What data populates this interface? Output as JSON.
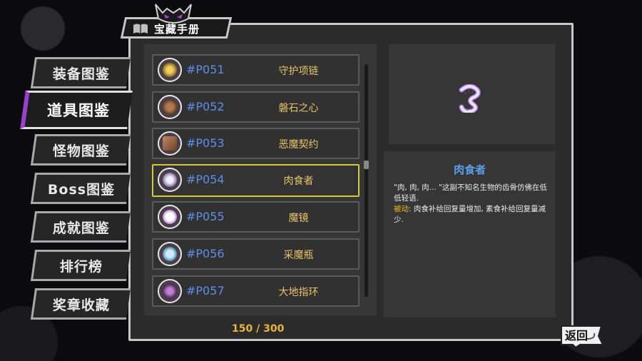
{
  "header": {
    "title": "宝藏手册"
  },
  "sidebar": {
    "items": [
      {
        "label": "装备图鉴",
        "active": false
      },
      {
        "label": "道具图鉴",
        "active": true
      },
      {
        "label": "怪物图鉴",
        "active": false
      },
      {
        "label": "Boss图鉴",
        "active": false
      },
      {
        "label": "成就图鉴",
        "active": false
      },
      {
        "label": "排行榜",
        "active": false
      },
      {
        "label": "奖章收藏",
        "active": false
      }
    ]
  },
  "list": {
    "items": [
      {
        "code": "#P051",
        "name": "守护项链",
        "icon": "necklace-icon",
        "color": "#c9a43a"
      },
      {
        "code": "#P052",
        "name": "磐石之心",
        "icon": "rock-heart-icon",
        "color": "#8a5a3a"
      },
      {
        "code": "#P053",
        "name": "恶魔契约",
        "icon": "scroll-icon",
        "color": "#a07050"
      },
      {
        "code": "#P054",
        "name": "肉食者",
        "icon": "jawbone-icon",
        "color": "#d8d0e8",
        "selected": true
      },
      {
        "code": "#P055",
        "name": "魔镜",
        "icon": "mirror-icon",
        "color": "#f0f0ff"
      },
      {
        "code": "#P056",
        "name": "采魔瓶",
        "icon": "bottle-icon",
        "color": "#6ab0d8"
      },
      {
        "code": "#P057",
        "name": "大地指环",
        "icon": "ring-icon",
        "color": "#7a4a8a"
      }
    ],
    "counter": "150 / 300"
  },
  "detail": {
    "title": "肉食者",
    "description": "\"肉, 肉, 肉... \"这副不知名生物的齿骨仿佛在低低轻语.",
    "passive_label": "被动:",
    "passive_text": " 肉食补给回复量增加, 素食补给回复量减少."
  },
  "back": {
    "label": "返回"
  },
  "colors": {
    "accent": "#9b3fd0",
    "code_blue": "#5d8fe8",
    "name_gold": "#e7c36a",
    "selected_border": "#d8c83c"
  }
}
